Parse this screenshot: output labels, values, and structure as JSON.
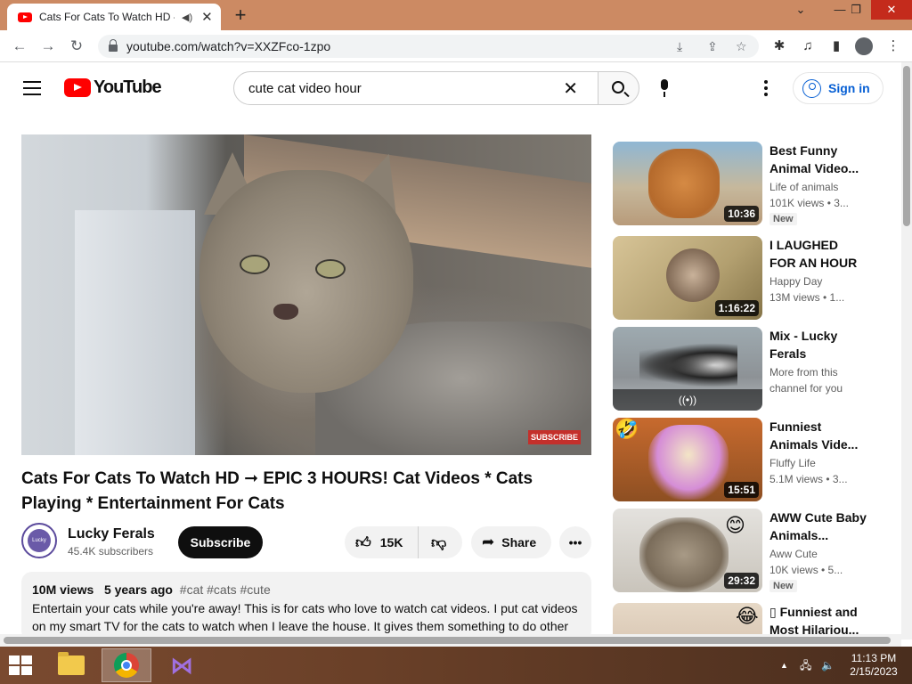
{
  "browser": {
    "tab_title": "Cats For Cats To Watch HD -",
    "tab_audio_icon": "speaker-icon",
    "tab_close": "✕",
    "new_tab": "+",
    "url": "youtube.com/watch?v=XXZFco-1zpo",
    "window_controls": [
      "⌄",
      "—",
      "❐",
      "✕"
    ]
  },
  "youtube": {
    "logo_text": "YouTube",
    "search_query": "cute cat video hour",
    "search_clear": "✕",
    "sign_in": "Sign in"
  },
  "player": {
    "subscribe_watermark": "SUBSCRIBE"
  },
  "video": {
    "title": "Cats For Cats To Watch HD ➞ EPIC 3 HOURS! Cat Videos * Cats Playing * Entertainment For Cats",
    "channel_name": "Lucky Ferals",
    "channel_avatar_text": "Lucky Ferals",
    "subscribers": "45.4K subscribers",
    "subscribe_label": "Subscribe",
    "likes": "15K",
    "share_label": "Share",
    "more_label": "•••",
    "views": "10M views",
    "age": "5 years ago",
    "hashtags": "#cat #cats #cute",
    "description": "Entertain your cats while you're away! This is for cats who love to watch cat videos. I put cat videos on my smart TV for the cats to watch when I leave the house. It gives them something to do other"
  },
  "recommendations": [
    {
      "title": "Best Funny Animal Video...",
      "channel": "Life of animals",
      "stats": "101K views • 3...",
      "badge": "New",
      "duration": "10:36"
    },
    {
      "title": "I LAUGHED FOR AN HOUR😹...",
      "channel": "Happy Day",
      "stats": "13M views • 1...",
      "badge": "",
      "duration": "1:16:22"
    },
    {
      "title": "Mix - Lucky Ferals",
      "channel": "More from this",
      "channel2": "channel for you",
      "stats": "",
      "badge": "",
      "duration": "",
      "live_icon": "((•))"
    },
    {
      "title": "Funniest Animals Vide...",
      "channel": "Fluffy Life",
      "stats": "5.1M views • 3...",
      "badge": "",
      "duration": "15:51"
    },
    {
      "title": "AWW Cute Baby Animals...",
      "channel": "Aww Cute",
      "stats": "10K views • 5...",
      "badge": "New",
      "duration": "29:32"
    },
    {
      "title": "▯ Funniest and Most Hilariou...",
      "channel": "",
      "stats": "",
      "badge": "",
      "duration": ""
    }
  ],
  "taskbar": {
    "time": "11:13 PM",
    "date": "2/15/2023",
    "tray_up": "▲"
  },
  "colors": {
    "brand_red": "#ff0000",
    "link_blue": "#065fd4",
    "tabbar": "#cc8a63"
  }
}
